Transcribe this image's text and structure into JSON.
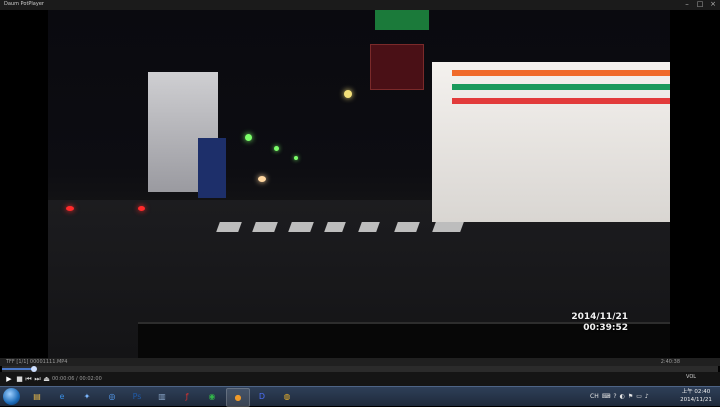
{
  "window": {
    "title": "Daum PotPlayer"
  },
  "window_controls": [
    "–",
    "□",
    "×"
  ],
  "video": {
    "osd_date": "2014/11/21",
    "osd_time": "00:39:52"
  },
  "status_bar": {
    "file_info": "TFF  [1/1] 00001111.MP4",
    "duration": "2:40:38"
  },
  "seek": {
    "progress": 0.045
  },
  "controls": {
    "play_icon": "▶",
    "stop_icon": "■",
    "prev_icon": "⏮",
    "next_icon": "⏭",
    "eject_icon": "⏏",
    "time_text": "00:00:06  /  00:02:00",
    "volume_label": "VOL"
  },
  "taskbar": {
    "icons": [
      {
        "name": "explorer-icon",
        "glyph": "▤",
        "color": "#e7b84a"
      },
      {
        "name": "ie-icon",
        "glyph": "e",
        "color": "#3a8de0"
      },
      {
        "name": "mercury-icon",
        "glyph": "✦",
        "color": "#7bb7ff"
      },
      {
        "name": "app-blue-icon",
        "glyph": "◎",
        "color": "#59a6ff"
      },
      {
        "name": "photoshop-icon",
        "glyph": "Ps",
        "color": "#1f5aa8"
      },
      {
        "name": "document-icon",
        "glyph": "▥",
        "color": "#8aa6c8"
      },
      {
        "name": "flash-icon",
        "glyph": "ƒ",
        "color": "#d8302e"
      },
      {
        "name": "line-icon",
        "glyph": "◉",
        "color": "#32b54a"
      },
      {
        "name": "potplayer-icon",
        "glyph": "●",
        "color": "#f09a2a"
      },
      {
        "name": "daum-icon",
        "glyph": "D",
        "color": "#4c6ef5"
      },
      {
        "name": "chrome-icon",
        "glyph": "◍",
        "color": "#e9b12c"
      }
    ],
    "tray": [
      "CH",
      "⌨",
      "?",
      "◐",
      "⚑",
      "▭",
      "♪"
    ],
    "clock_line1": "上午 02:40",
    "clock_line2": "2014/11/21"
  }
}
